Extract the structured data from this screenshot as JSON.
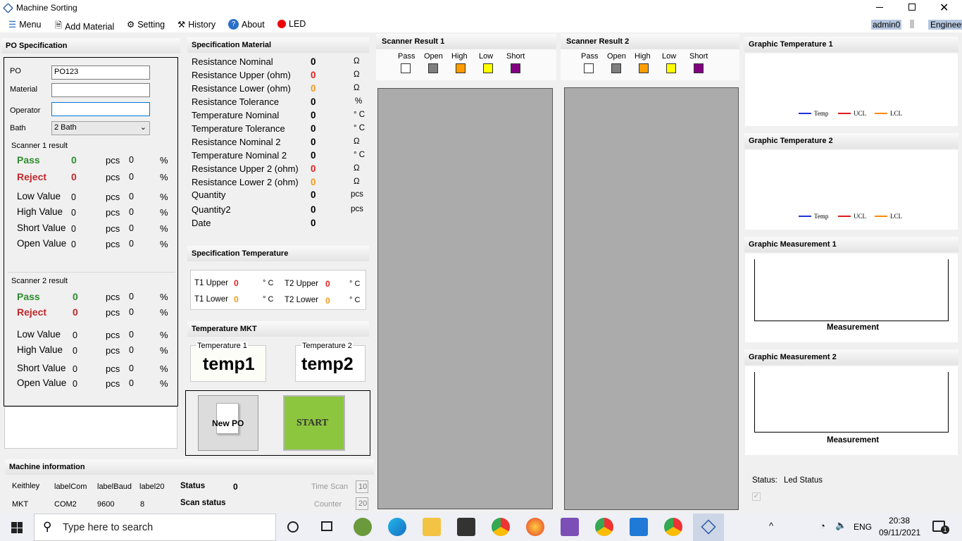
{
  "window": {
    "title": "Machine Sorting"
  },
  "menu": {
    "items": [
      "Menu",
      "Add Material",
      "Setting",
      "History",
      "About",
      "LED"
    ],
    "user": "admin0",
    "role": "Engineer"
  },
  "po": {
    "header": "PO Specification",
    "po_label": "PO",
    "po_value": "PO123",
    "material_label": "Material",
    "material_value": "",
    "operator_label": "Operator",
    "operator_value": "",
    "bath_label": "Bath",
    "bath_value": "2 Bath"
  },
  "scanner1": {
    "title": "Scanner 1 result",
    "pass": "Pass",
    "reject": "Reject",
    "low": "Low Value",
    "high": "High Value",
    "short": "Short Value",
    "open": "Open Value",
    "zero": "0",
    "pcs": "pcs",
    "pct": "%"
  },
  "scanner2": {
    "title": "Scanner 2 result"
  },
  "spec": {
    "header": "Specification Material",
    "rows": [
      {
        "label": "Resistance Nominal",
        "value": "0",
        "unit": "Ω",
        "color": "b"
      },
      {
        "label": "Resistance Upper (ohm)",
        "value": "0",
        "unit": "Ω",
        "color": "r"
      },
      {
        "label": "Resistance Lower (ohm)",
        "value": "0",
        "unit": "Ω",
        "color": "o"
      },
      {
        "label": "Resistance Tolerance",
        "value": "0",
        "unit": "%",
        "color": "b"
      },
      {
        "label": "Temperature Nominal",
        "value": "0",
        "unit": "° C",
        "color": "b"
      },
      {
        "label": "Temperature Tolerance",
        "value": "0",
        "unit": "° C",
        "color": "b"
      },
      {
        "label": "Resistance Nominal 2",
        "value": "0",
        "unit": "Ω",
        "color": "b"
      },
      {
        "label": "Temperature Nominal 2",
        "value": "0",
        "unit": "° C",
        "color": "b"
      },
      {
        "label": "Resistance Upper 2 (ohm)",
        "value": "0",
        "unit": "Ω",
        "color": "r"
      },
      {
        "label": "Resistance Lower 2 (ohm)",
        "value": "0",
        "unit": "Ω",
        "color": "o"
      },
      {
        "label": "Quantity",
        "value": "0",
        "unit": "pcs",
        "color": "b"
      },
      {
        "label": "Quantity2",
        "value": "0",
        "unit": "pcs",
        "color": "b"
      },
      {
        "label": "Date",
        "value": "0",
        "unit": "",
        "color": "b"
      }
    ]
  },
  "spec_temp": {
    "header": "Specification Temperature",
    "t1u": "T1 Upper",
    "t1l": "T1 Lower",
    "t2u": "T2 Upper",
    "t2l": "T2 Lower",
    "zero": "0",
    "unit": "° C"
  },
  "mkt": {
    "header": "Temperature MKT",
    "t1_label": "Temperature 1",
    "t1_value": "temp1",
    "t2_label": "Temperature 2",
    "t2_value": "temp2"
  },
  "actions": {
    "new_po": "New PO",
    "start": "START"
  },
  "machine": {
    "header": "Machine information",
    "keithley": "Keithley",
    "label_com": "labelCom",
    "label_baud": "labelBaud",
    "label20": "label20",
    "status_label": "Status",
    "status_value": "0",
    "mkt": "MKT",
    "com": "COM2",
    "baud": "9600",
    "num8": "8",
    "scan_status": "Scan status",
    "time_scan_label": "Time Scan",
    "time_scan_value": "10",
    "counter_label": "Counter",
    "counter_value": "20"
  },
  "scan1": {
    "header": "Scanner Result 1"
  },
  "scan2": {
    "header": "Scanner Result 2"
  },
  "scan_legend": [
    "Pass",
    "Open",
    "High",
    "Low",
    "Short"
  ],
  "scan_colors": [
    "#ffffff",
    "#7f7f7f",
    "#ff9c00",
    "#ffff00",
    "#800080"
  ],
  "graphs": {
    "gt1": "Graphic Temperature 1",
    "gt2": "Graphic Temperature 2",
    "gm1": "Graphic Measurement 1",
    "gm2": "Graphic Measurement 2",
    "legend": [
      "Temp",
      "UCL",
      "LCL"
    ],
    "measurement": "Measurement"
  },
  "status": {
    "label": "Status:",
    "value": "Led Status"
  },
  "taskbar": {
    "search": "Type here to search",
    "lang": "ENG",
    "time": "20:38",
    "date": "09/11/2021",
    "notif": "1"
  }
}
